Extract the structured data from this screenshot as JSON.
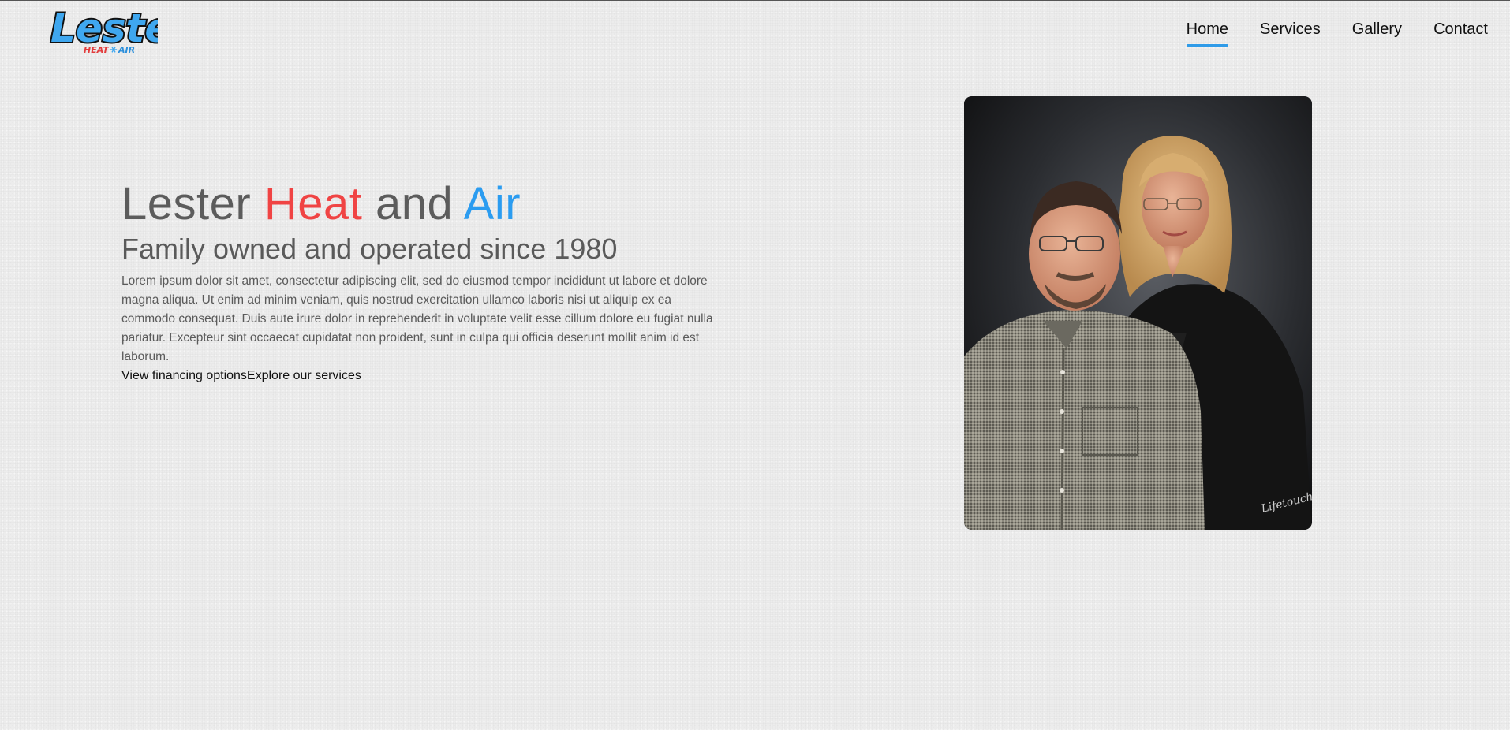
{
  "header": {
    "logo": {
      "wordmark": "Lester",
      "sub_left": "HEAT",
      "sub_right": "AIR"
    },
    "nav": [
      {
        "label": "Home",
        "active": true
      },
      {
        "label": "Services",
        "active": false
      },
      {
        "label": "Gallery",
        "active": false
      },
      {
        "label": "Contact",
        "active": false
      }
    ]
  },
  "hero": {
    "title": {
      "part1": "Lester ",
      "heat": "Heat",
      "part2": " and ",
      "air": "Air"
    },
    "subtitle": "Family owned and operated since 1980",
    "body": "Lorem ipsum dolor sit amet, consectetur adipiscing elit, sed do eiusmod tempor incididunt ut labore et dolore magna aliqua. Ut enim ad minim veniam, quis nostrud exercitation ullamco laboris nisi ut aliquip ex ea commodo consequat. Duis aute irure dolor in reprehenderit in voluptate velit esse cillum dolore eu fugiat nulla pariatur. Excepteur sint occaecat cupidatat non proident, sunt in culpa qui officia deserunt mollit anim id est laborum.",
    "links": {
      "financing": "View financing options",
      "services": "Explore our services"
    }
  },
  "photo": {
    "signature": "Lifetouch"
  },
  "colors": {
    "heat": "#f04444",
    "air": "#2b9cf0",
    "text_gray": "#5c5c5c",
    "nav_underline": "#2f9be8"
  }
}
